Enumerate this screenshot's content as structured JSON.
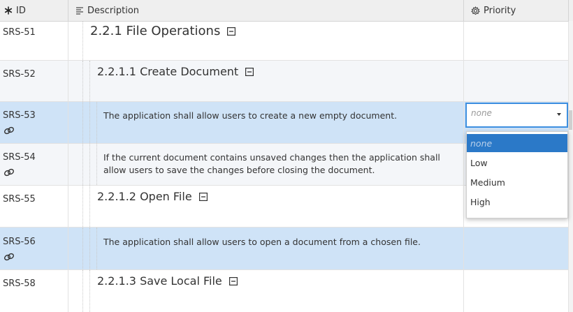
{
  "header": {
    "id_label": "ID",
    "description_label": "Description",
    "priority_label": "Priority"
  },
  "rows": [
    {
      "id": "SRS-51",
      "text": "2.2.1 File Operations",
      "kind": "heading-2"
    },
    {
      "id": "SRS-52",
      "text": "2.2.1.1 Create Document",
      "kind": "heading-3"
    },
    {
      "id": "SRS-53",
      "text": "The application shall allow users to create a new empty document.",
      "kind": "requirement",
      "selected": true
    },
    {
      "id": "SRS-54",
      "text_line1": "If the current document contains unsaved changes then the application shall",
      "text_line2": "allow users to save the changes before closing the document.",
      "kind": "requirement"
    },
    {
      "id": "SRS-55",
      "text": "2.2.1.2 Open File",
      "kind": "heading-3"
    },
    {
      "id": "SRS-56",
      "text": "The application shall allow users to open a document from a chosen file.",
      "kind": "requirement",
      "selected": true
    },
    {
      "id": "SRS-58",
      "text": "2.2.1.3 Save Local File",
      "kind": "heading-3"
    }
  ],
  "priority_select": {
    "value": "none",
    "options": [
      "none",
      "Low",
      "Medium",
      "High"
    ],
    "highlighted": "none"
  },
  "colors": {
    "selected_row": "#cfe3f7",
    "alt_row": "#f4f6f9",
    "focus_border": "#3d8fe0",
    "menu_highlight": "#2b79c8"
  },
  "icons": {
    "id_column": "asterisk-icon",
    "description_column": "text-lines-icon",
    "priority_column": "gear-icon",
    "link": "link-icon",
    "collapse": "collapse-toggle-icon"
  }
}
